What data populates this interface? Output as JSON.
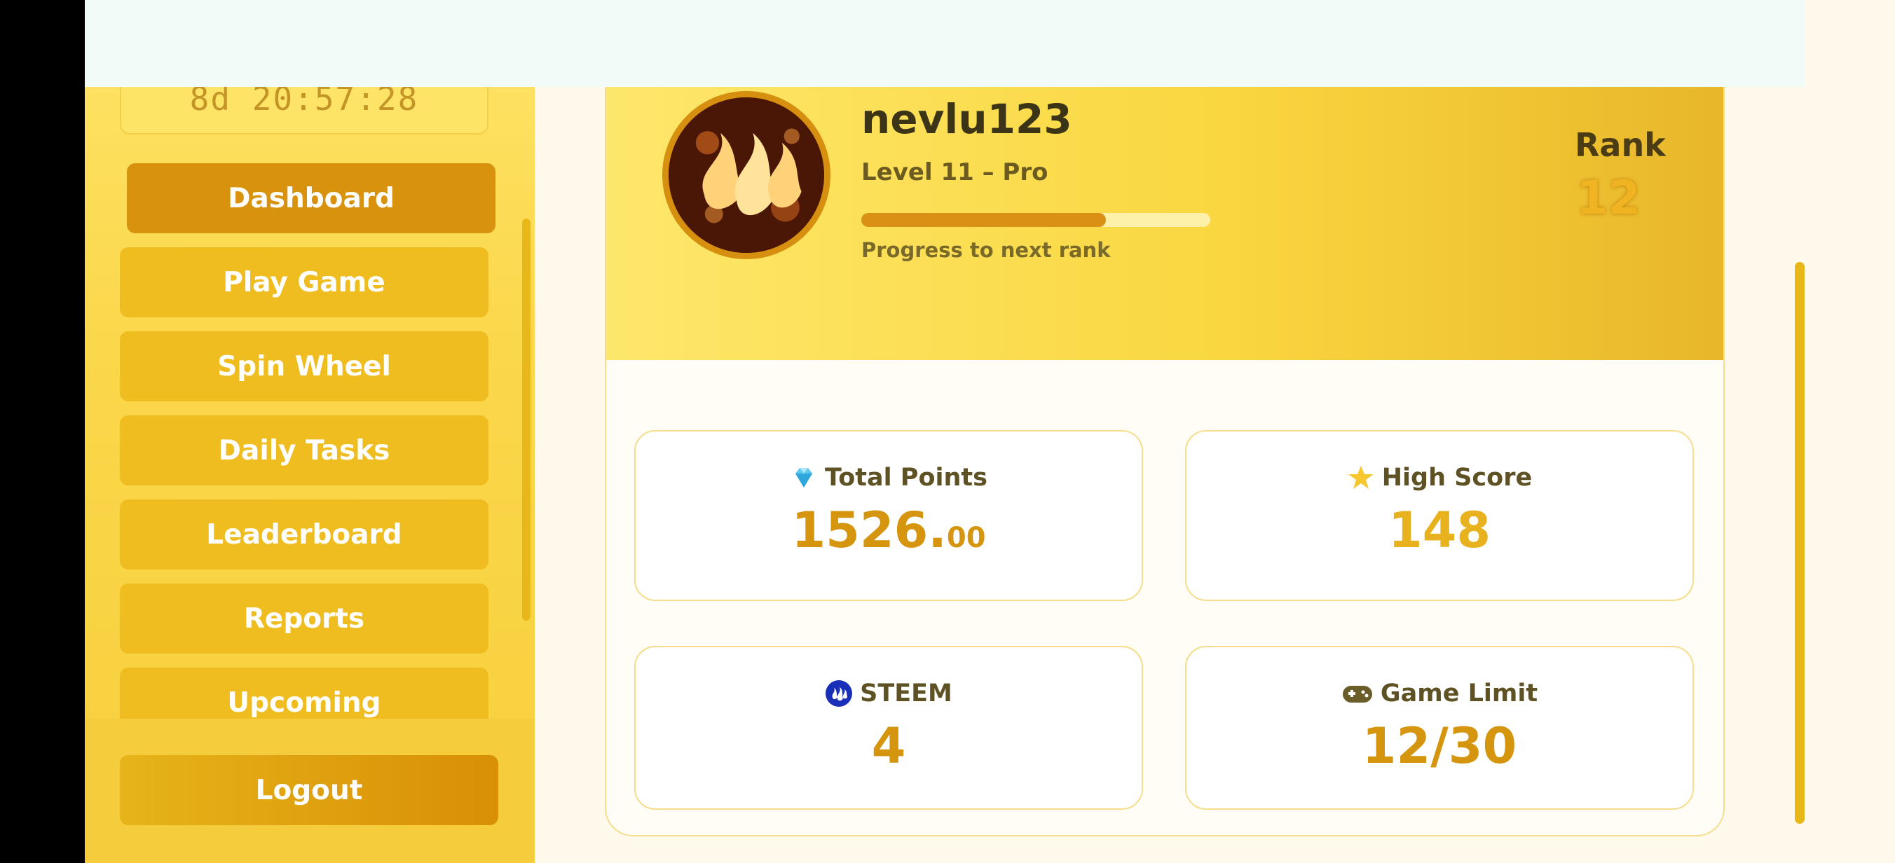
{
  "topbar": {},
  "sidebar": {
    "timer": "8d 20:57:28",
    "items": [
      {
        "label": "Dashboard",
        "active": true
      },
      {
        "label": "Play Game",
        "active": false
      },
      {
        "label": "Spin Wheel",
        "active": false
      },
      {
        "label": "Daily Tasks",
        "active": false
      },
      {
        "label": "Leaderboard",
        "active": false
      },
      {
        "label": "Reports",
        "active": false
      },
      {
        "label": "Upcoming",
        "active": false
      }
    ],
    "logout_label": "Logout"
  },
  "profile": {
    "username": "nevlu123",
    "level": "Level 11 – Pro",
    "progress_fraction": 0.7,
    "progress_label": "Progress to next rank",
    "rank_label": "Rank",
    "rank_value": "12"
  },
  "stats": {
    "total_points": {
      "label": "Total Points",
      "value_int": "1526.",
      "value_dec": "00",
      "icon": "gem-icon"
    },
    "high_score": {
      "label": "High Score",
      "value": "148",
      "icon": "star-icon"
    },
    "steem": {
      "label": "STEEM",
      "value": "4",
      "icon": "steem-icon"
    },
    "game_limit": {
      "label": "Game Limit",
      "value": "12/30",
      "icon": "gamepad-icon"
    }
  },
  "colors": {
    "accent": "#d8920d",
    "sidebar_bg": "#fbd74a",
    "button_bg": "#efbd1f",
    "value_text": "#d5950f"
  }
}
